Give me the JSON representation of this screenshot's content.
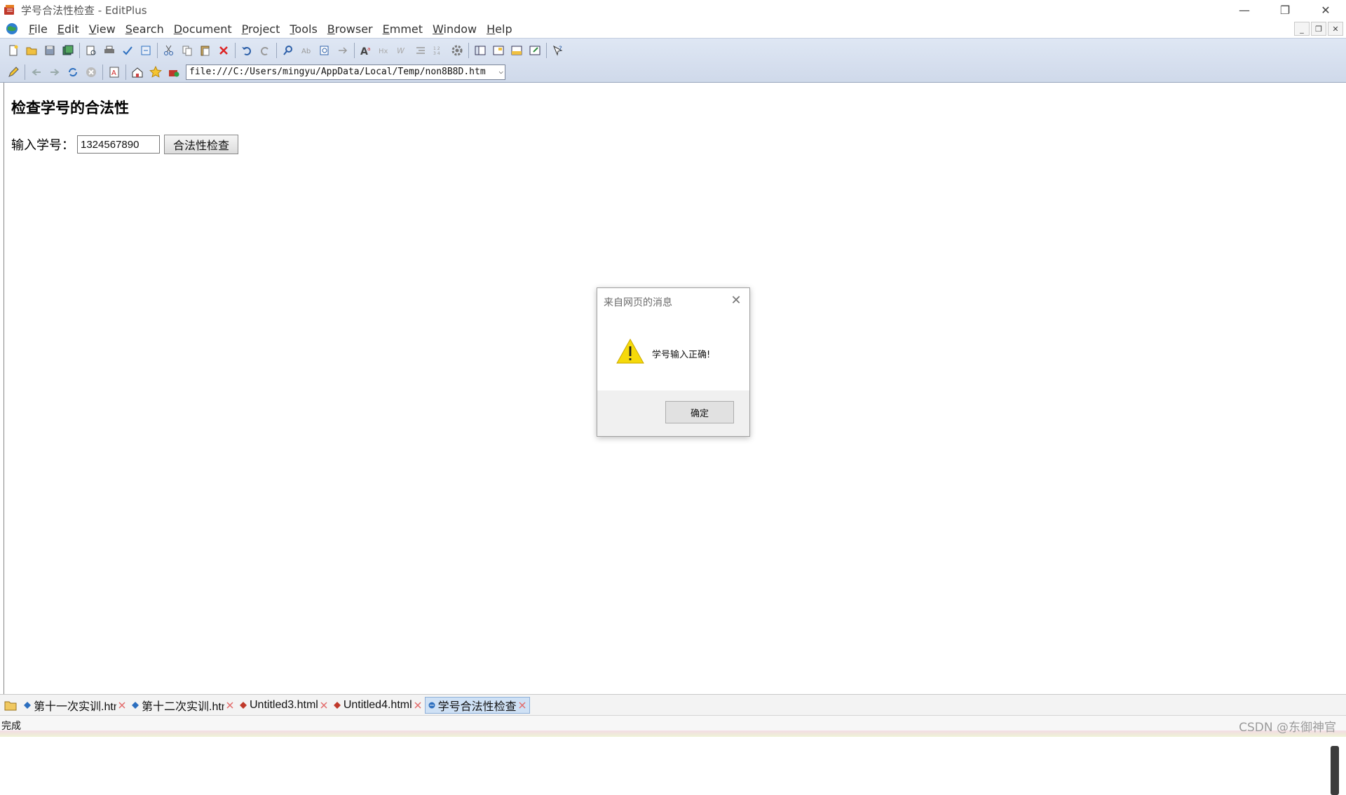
{
  "window": {
    "title": "学号合法性检查 - EditPlus",
    "controls": {
      "minimize": "—",
      "restore": "❐",
      "close": "✕"
    }
  },
  "menu": {
    "items": [
      {
        "label": "File",
        "accel": "F"
      },
      {
        "label": "Edit",
        "accel": "E"
      },
      {
        "label": "View",
        "accel": "V"
      },
      {
        "label": "Search",
        "accel": "S"
      },
      {
        "label": "Document",
        "accel": "D"
      },
      {
        "label": "Project",
        "accel": "P"
      },
      {
        "label": "Tools",
        "accel": "T"
      },
      {
        "label": "Browser",
        "accel": "B"
      },
      {
        "label": "Emmet",
        "accel": "E"
      },
      {
        "label": "Window",
        "accel": "W"
      },
      {
        "label": "Help",
        "accel": "H"
      }
    ],
    "mdi_controls": {
      "minimize": "_",
      "restore": "❐",
      "close": "✕"
    }
  },
  "browser": {
    "url": "file:///C:/Users/mingyu/AppData/Local/Temp/non8B8D.htm",
    "dropdown_arrow": "⌵"
  },
  "page": {
    "heading": "检查学号的合法性",
    "input_label": "输入学号：",
    "input_value": "1324567890",
    "check_button": "合法性检查"
  },
  "dialog": {
    "title": "来自网页的消息",
    "close_glyph": "✕",
    "message": "学号输入正确!",
    "ok_button": "确定"
  },
  "tabs": [
    {
      "label": "第十一次实训.html",
      "active": false
    },
    {
      "label": "第十二次实训.html",
      "active": false
    },
    {
      "label": "Untitled3.html",
      "active": false
    },
    {
      "label": "Untitled4.html",
      "active": false
    },
    {
      "label": "学号合法性检查",
      "active": true
    }
  ],
  "status": {
    "text": "完成",
    "watermark": "CSDN @东御神官"
  },
  "colors": {
    "toolbar_bg": "#d6dfee",
    "active_tab": "#cfe1f5",
    "warning_yellow": "#f5d90a",
    "dialog_footer": "#f0f0f0"
  }
}
